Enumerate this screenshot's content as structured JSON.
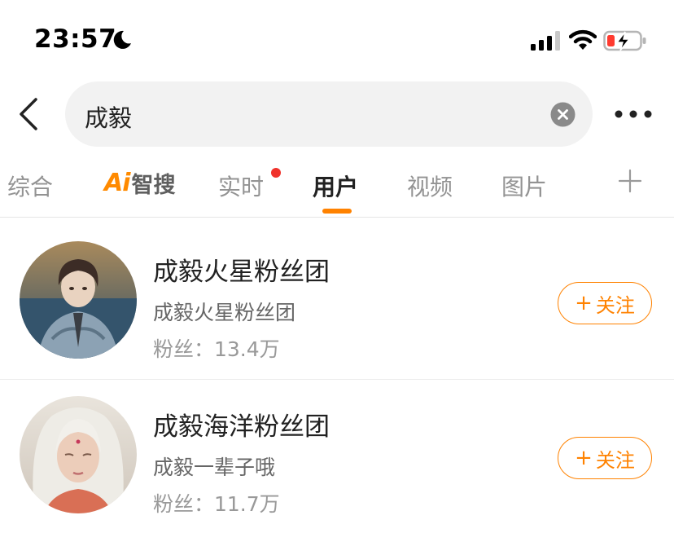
{
  "status_bar": {
    "time": "23:57",
    "icons": [
      "moon-icon",
      "signal-icon",
      "wifi-icon",
      "battery-charging-icon"
    ],
    "battery_color": "#ff3b30"
  },
  "search": {
    "query": "成毅",
    "icons": [
      "back-icon",
      "clear-icon",
      "more-icon"
    ]
  },
  "tabs": {
    "items": [
      "综合",
      "Ai智搜",
      "实时",
      "用户",
      "视频",
      "图片"
    ],
    "ai_mark": "Ai",
    "ai_text": "智搜",
    "active": "用户",
    "has_badge": "实时",
    "accent_color": "#ff8200"
  },
  "users": [
    {
      "name": "成毅火星粉丝团",
      "description": "成毅火星粉丝团",
      "fans": "粉丝：13.4万",
      "follow_label": "关注",
      "follow_plus": "+"
    },
    {
      "name": "成毅海洋粉丝团",
      "description": "成毅一辈子哦",
      "fans": "粉丝：11.7万",
      "follow_label": "关注",
      "follow_plus": "+"
    }
  ]
}
